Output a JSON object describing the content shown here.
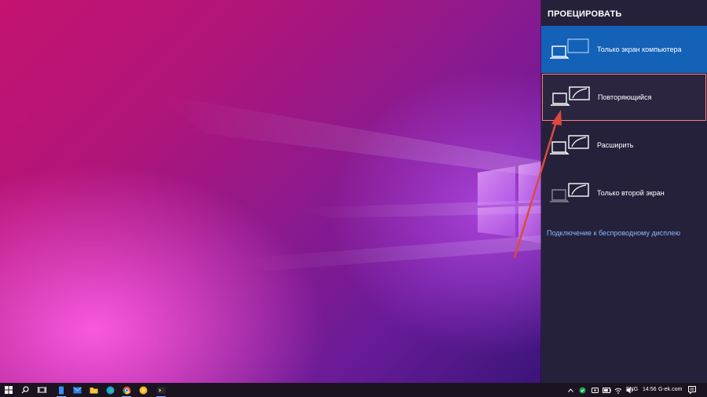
{
  "project_panel": {
    "title": "ПРОЕЦИРОВАТЬ",
    "options": [
      {
        "label": "Только экран компьютера",
        "icon": "pc-screen-only-icon",
        "state": "active"
      },
      {
        "label": "Повторяющийся",
        "icon": "duplicate-icon",
        "state": "highlighted"
      },
      {
        "label": "Расширить",
        "icon": "extend-icon",
        "state": "normal"
      },
      {
        "label": "Только второй экран",
        "icon": "second-screen-only-icon",
        "state": "normal"
      }
    ],
    "wireless_link": "Подключение к беспроводному дисплею"
  },
  "taskbar": {
    "apps": [
      "start-icon",
      "search-icon",
      "task-view-icon",
      "phone-app-icon",
      "mail-icon",
      "file-explorer-icon",
      "edge-icon",
      "chrome-icon",
      "yellow-app-icon",
      "terminal-icon"
    ],
    "tray": {
      "language": "ENG",
      "clock": "14:56",
      "watermark": "G-ek.com"
    }
  },
  "colors": {
    "panel_bg": "#26213a",
    "active_option": "#1461b8",
    "highlight_border": "#ff8080",
    "link": "#8ab8ff",
    "arrow": "#e0483e",
    "taskbar": "#1b1420"
  }
}
